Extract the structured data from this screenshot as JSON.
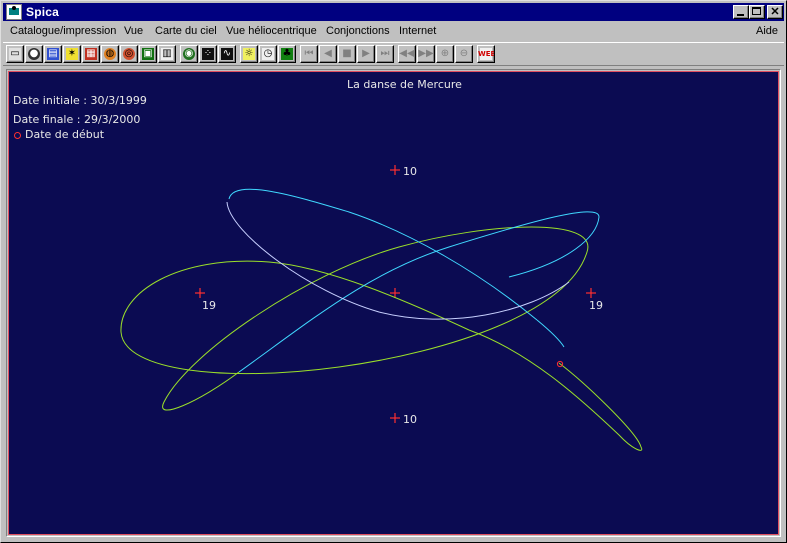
{
  "window": {
    "title": "Spica"
  },
  "menu": {
    "items": [
      "Catalogue/impression",
      "Vue",
      "Carte du ciel",
      "Vue héliocentrique",
      "Conjonctions",
      "Internet"
    ],
    "help": "Aide"
  },
  "toolbar": {
    "buttons": [
      {
        "icon": "printer-icon",
        "glyph": "▭",
        "enabled": true
      },
      {
        "icon": "globe-dark-icon",
        "glyph": "●",
        "enabled": true
      },
      {
        "icon": "landscape-icon",
        "glyph": "▤",
        "enabled": true
      },
      {
        "icon": "star-yellow-icon",
        "glyph": "✶",
        "enabled": true
      },
      {
        "icon": "constellation-icon",
        "glyph": "▦",
        "enabled": true
      },
      {
        "icon": "planet-orange-icon",
        "glyph": "◍",
        "enabled": true
      },
      {
        "icon": "saturn-icon",
        "glyph": "◎",
        "enabled": true
      },
      {
        "icon": "grid-monitor-icon",
        "glyph": "▣",
        "enabled": true
      },
      {
        "icon": "table-icon",
        "glyph": "▥",
        "enabled": true
      },
      {
        "icon": "earth-icon",
        "glyph": "◉",
        "enabled": true
      },
      {
        "icon": "sky-dots-icon",
        "glyph": "⁘",
        "enabled": true
      },
      {
        "icon": "orbit-chart-icon",
        "glyph": "∿",
        "enabled": true
      },
      {
        "icon": "sun-image-icon",
        "glyph": "☼",
        "enabled": true
      },
      {
        "icon": "clock-icon",
        "glyph": "◷",
        "enabled": true
      },
      {
        "icon": "tree-icon",
        "glyph": "♣",
        "enabled": true
      },
      {
        "icon": "first-frame-icon",
        "glyph": "⏮",
        "enabled": false
      },
      {
        "icon": "previous-frame-icon",
        "glyph": "◀",
        "enabled": false
      },
      {
        "icon": "stop-icon",
        "glyph": "■",
        "enabled": false
      },
      {
        "icon": "next-frame-icon",
        "glyph": "▶",
        "enabled": false
      },
      {
        "icon": "last-frame-icon",
        "glyph": "⏭",
        "enabled": false
      },
      {
        "icon": "rewind-icon",
        "glyph": "◀◀",
        "enabled": false
      },
      {
        "icon": "fast-forward-icon",
        "glyph": "▶▶",
        "enabled": false
      },
      {
        "icon": "zoom-in-icon",
        "glyph": "⊕",
        "enabled": false
      },
      {
        "icon": "zoom-out-icon",
        "glyph": "⊖",
        "enabled": false
      },
      {
        "icon": "web-icon",
        "glyph": "WEB",
        "enabled": true
      }
    ]
  },
  "sky": {
    "title": "La danse de Mercure",
    "date_start": "Date initiale : 30/3/1999",
    "date_end": "Date finale : 29/3/2000",
    "legend_label": "Date de début",
    "colors": {
      "background": "#0b0b52",
      "frame": "#e05060",
      "marker": "#ff3030",
      "text": "#e8e8e8",
      "path_green": "#9be02a",
      "path_cyan": "#40d8ff",
      "path_pale": "#c8d0ff"
    },
    "markers": [
      {
        "label": "10",
        "position": "top"
      },
      {
        "label": "19",
        "position": "left"
      },
      {
        "label": "",
        "position": "center"
      },
      {
        "label": "19",
        "position": "right"
      },
      {
        "label": "10",
        "position": "bottom"
      }
    ]
  }
}
